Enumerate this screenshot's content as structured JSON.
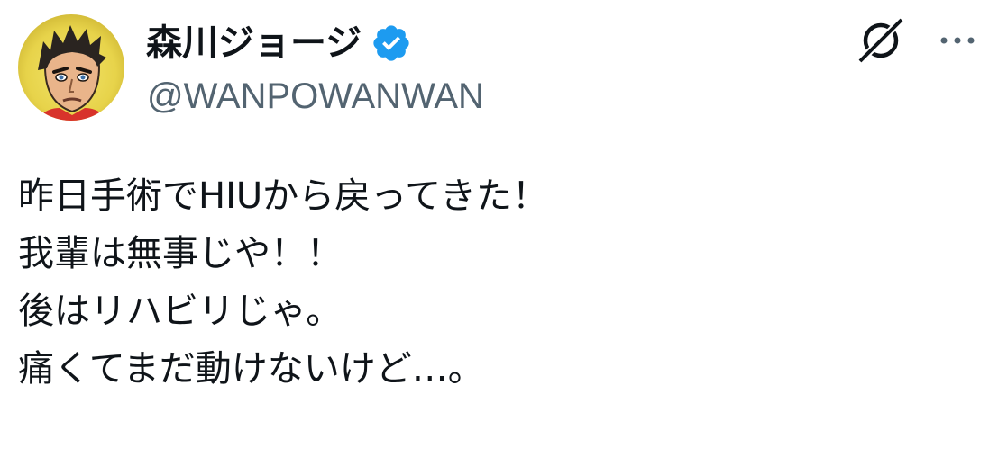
{
  "author": {
    "display_name": "森川ジョージ",
    "handle": "@WANPOWANWAN",
    "verified": true,
    "avatar_icon": "manga-character-avatar"
  },
  "toolbar": {
    "grok_icon": "grok-icon",
    "more_icon": "more-options-icon"
  },
  "tweet": {
    "lines": [
      "昨日手術でHIUから戻ってきた！",
      "我輩は無事じや！！",
      "後はリハビリじゃ。",
      "痛くてまだ動けないけど…。"
    ]
  },
  "colors": {
    "text": "#0f1419",
    "secondary_text": "#536471",
    "verified_blue": "#1d9bf0",
    "background": "#ffffff"
  }
}
